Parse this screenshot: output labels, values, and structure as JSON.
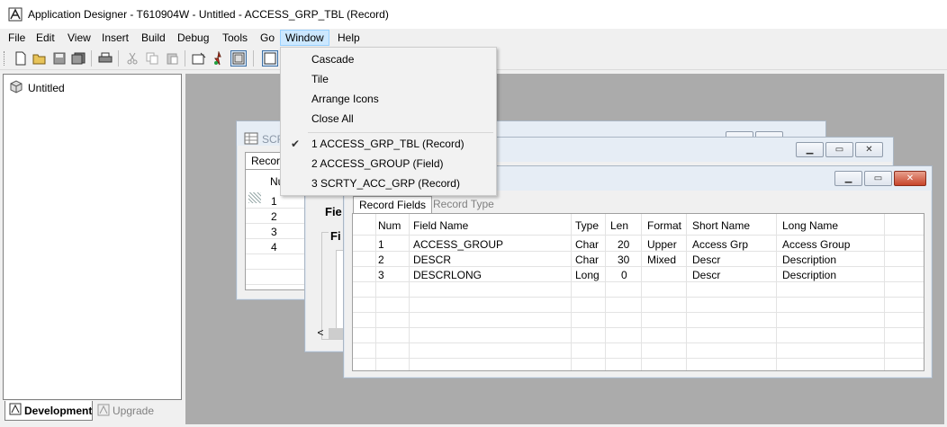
{
  "window": {
    "title": "Application Designer - T610904W - Untitled - ACCESS_GRP_TBL (Record)"
  },
  "menubar": {
    "items": [
      "File",
      "Edit",
      "View",
      "Insert",
      "Build",
      "Debug",
      "Tools",
      "Go",
      "Window",
      "Help"
    ],
    "open_item": "Window"
  },
  "toolbar": {
    "icons": [
      "new-icon",
      "open-icon",
      "save-icon",
      "save-all-icon",
      "print-icon",
      "cut-icon",
      "copy-icon",
      "paste-icon",
      "properties-icon",
      "run-icon",
      "project-workspace-icon",
      "object-icon"
    ]
  },
  "window_menu": {
    "items": [
      {
        "label": "Cascade",
        "checked": false
      },
      {
        "label": "Tile",
        "checked": false
      },
      {
        "label": "Arrange Icons",
        "checked": false
      },
      {
        "label": "Close All",
        "checked": false
      },
      {
        "label": "1 ACCESS_GRP_TBL (Record)",
        "checked": true
      },
      {
        "label": "2 ACCESS_GROUP (Field)",
        "checked": false
      },
      {
        "label": "3 SCRTY_ACC_GRP (Record)",
        "checked": false
      }
    ]
  },
  "project": {
    "root": "Untitled"
  },
  "bottom_tabs": {
    "development": "Development",
    "upgrade": "Upgrade"
  },
  "scrty_window": {
    "title_partial": "SCR",
    "tab_partial": "Recor",
    "col_partial": "Nu",
    "rows": [
      "1",
      "2",
      "3",
      "4"
    ]
  },
  "field_window": {
    "label1": "Fie",
    "label2": "Fi",
    "scroll_left": "<"
  },
  "record_window": {
    "tabs": {
      "fields": "Record Fields",
      "type": "Record Type"
    },
    "columns": [
      "Num",
      "Field Name",
      "Type",
      "Len",
      "Format",
      "Short Name",
      "Long Name"
    ],
    "rows": [
      [
        "1",
        "ACCESS_GROUP",
        "Char",
        "20",
        "Upper",
        "Access Grp",
        "Access Group"
      ],
      [
        "2",
        "DESCR",
        "Char",
        "30",
        "Mixed",
        "Descr",
        "Description"
      ],
      [
        "3",
        "DESCRLONG",
        "Long",
        "0",
        "",
        "Descr",
        "Description"
      ]
    ],
    "buttons": {
      "minimize": "▁",
      "maximize": "▭",
      "close": "✕"
    }
  },
  "colors": {
    "menu_highlight": "#cce8ff",
    "mdi_background": "#ababab",
    "close_button": "#c7452b"
  }
}
